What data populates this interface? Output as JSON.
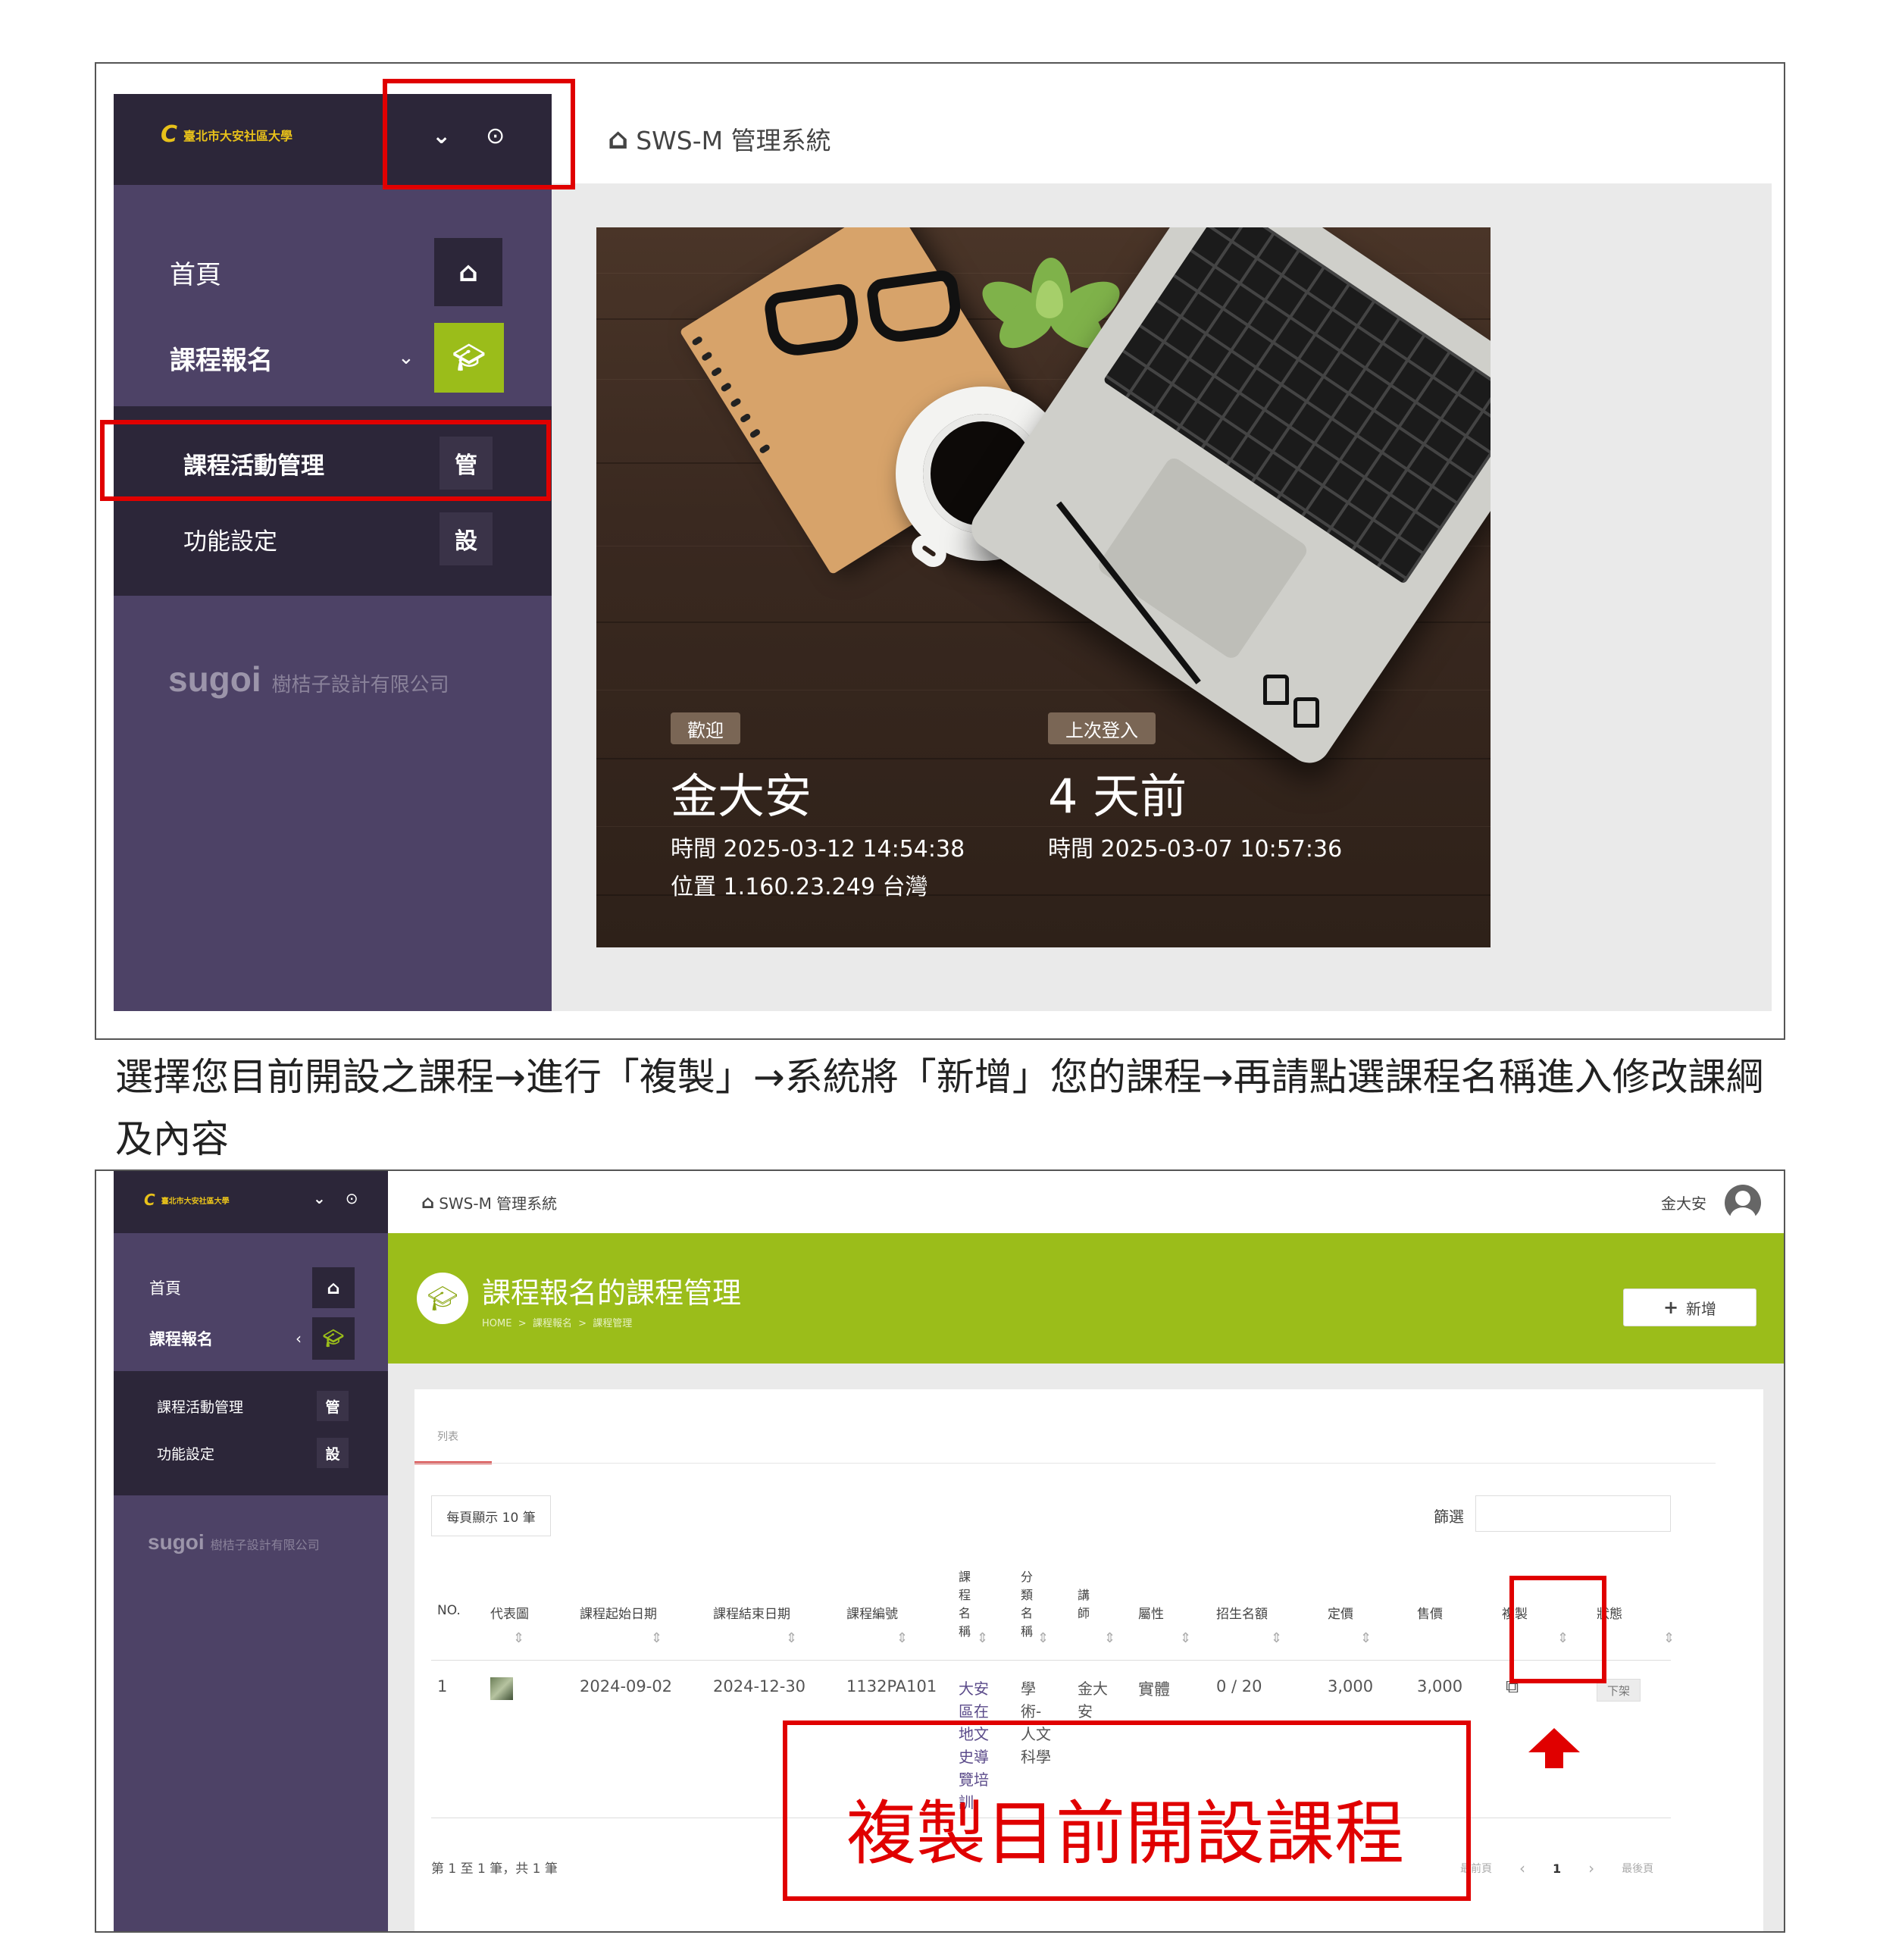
{
  "app": {
    "school_logo_text": "臺北市大安社區大學",
    "system_title": "SWS-M 管理系統",
    "brand_mark": "sugoi",
    "brand_company": "樹桔子設計有限公司"
  },
  "sidebar": {
    "items": [
      {
        "label": "首頁",
        "icon": "home-icon"
      },
      {
        "label": "課程報名",
        "icon": "graduation-cap-icon"
      }
    ],
    "subitems": [
      {
        "label": "課程活動管理",
        "badge": "管"
      },
      {
        "label": "功能設定",
        "badge": "設"
      }
    ]
  },
  "hero": {
    "welcome_badge": "歡迎",
    "user_name": "金大安",
    "current_time": "時間 2025-03-12 14:54:38",
    "location": "位置 1.160.23.249 台灣",
    "last_login_badge": "上次登入",
    "last_login_ago": "4 天前",
    "last_login_time": "時間 2025-03-07 10:57:36"
  },
  "instruction": "選擇您目前開設之課程→進行「複製」→系統將「新增」您的課程→再請點選課程名稱進入修改課綱及內容",
  "manage": {
    "user_name": "金大安",
    "page_title": "課程報名的課程管理",
    "breadcrumb": "HOME  >  課程報名  >  課程管理",
    "add_button": "新增",
    "tab_list": "列表",
    "page_size": "每頁顯示 10 筆",
    "filter_label": "篩選",
    "columns": [
      "NO.",
      "代表圖",
      "課程起始日期",
      "課程結束日期",
      "課程編號",
      "課程名稱",
      "分類名稱",
      "講師",
      "屬性",
      "招生名額",
      "定價",
      "售價",
      "複製",
      "狀態"
    ],
    "rows": [
      {
        "no": "1",
        "start": "2024-09-02",
        "end": "2024-12-30",
        "code": "1132PA101",
        "name": "大安區在地文史導覽培訓",
        "category": "學術-人文科學",
        "teacher": "金大安",
        "attr": "實體",
        "quota": "0 / 20",
        "price": "3,000",
        "sale": "3,000",
        "status": "下架"
      }
    ],
    "info": "第 1 至 1 筆，共 1 筆",
    "pager_first": "最前頁",
    "pager_prev": "‹",
    "pager_page": "1",
    "pager_next": "›",
    "pager_last": "最後頁"
  },
  "annotation": {
    "callout": "複製目前開設課程"
  },
  "colors": {
    "sidebar": "#4d4266",
    "sidebar_dark": "#2c2639",
    "accent_green": "#9bbd1a",
    "annotation_red": "#e00000"
  }
}
